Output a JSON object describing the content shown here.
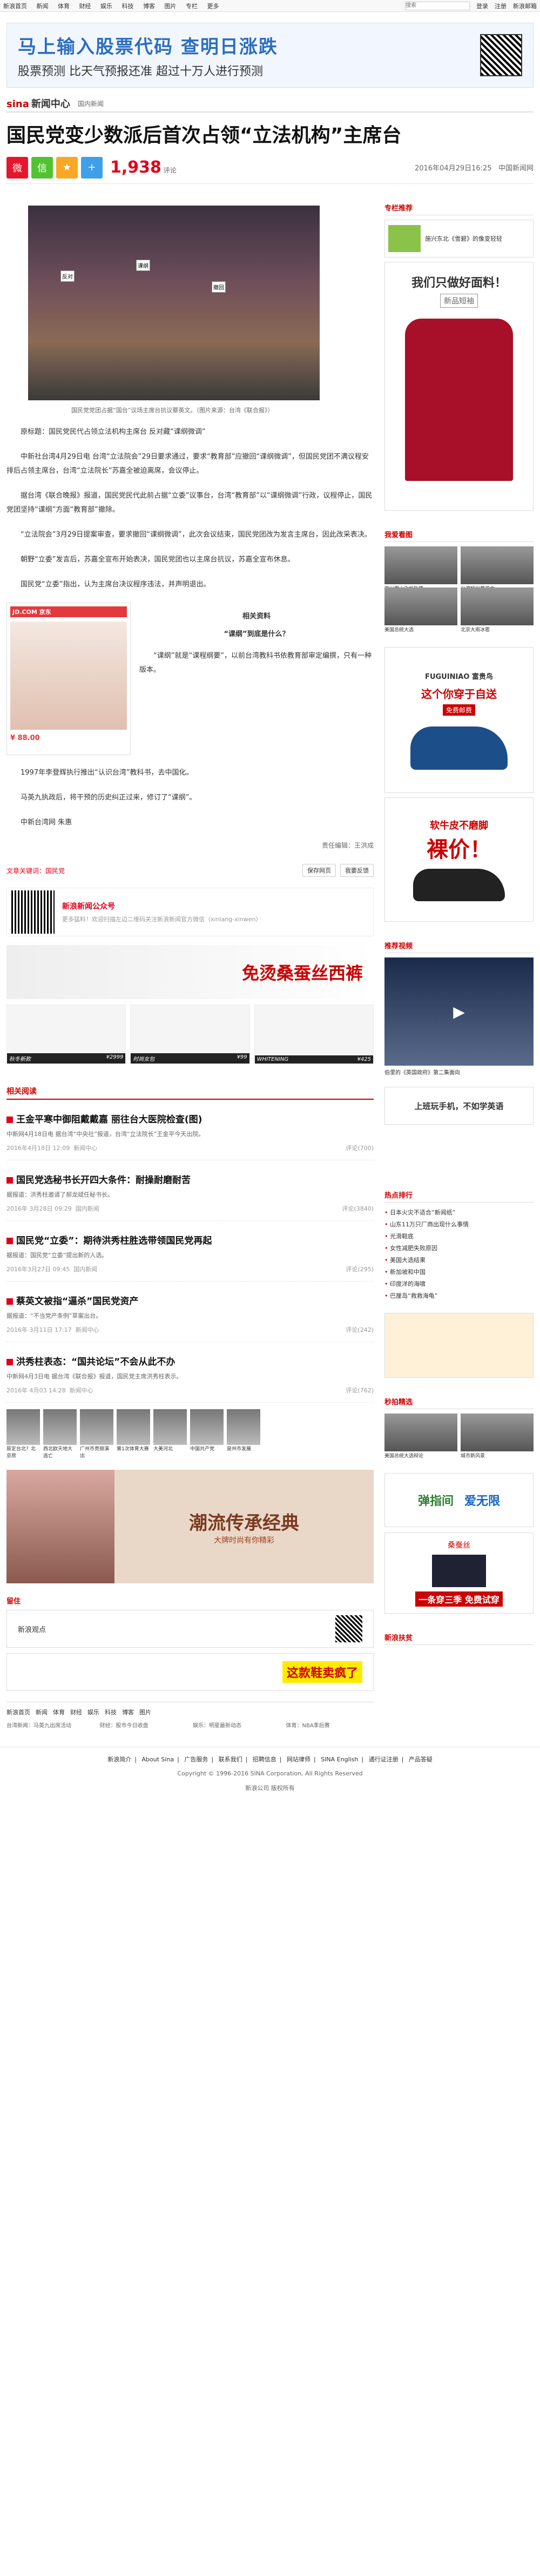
{
  "topbar": {
    "nav": [
      "新浪首页",
      "新闻",
      "体育",
      "财经",
      "娱乐",
      "科技",
      "博客",
      "图片",
      "专栏",
      "更多"
    ],
    "search_placeholder": "搜索",
    "login": "登录",
    "register": "注册",
    "mail": "新浪邮箱"
  },
  "banner": {
    "title": "马上输入股票代码  查明日涨跌",
    "sub": "股票预测  比天气预报还准  超过十万人进行预测"
  },
  "channel": {
    "logo": "sina",
    "name": "新闻中心",
    "crumb": "国内新闻"
  },
  "article": {
    "title": "国民党变少数派后首次占领“立法机构”主席台",
    "count": "1,938",
    "count_label": "评论",
    "date": "2016年04月29日16:25",
    "source": "中国新闻网",
    "caption": "国民党党团占据“国台”议场主席台抗议蔡英文。（图片来源：台湾《联合报》）",
    "p1": "原标题：国民党民代占领立法机构主席台 反对藏“课纲微调”",
    "p2": "中新社台湾4月29日电 台湾“立法院会”29日要求通过，要求“教育部”应撤回“课纲微调”，但国民党团不满议程安排后占领主席台，台湾“立法院长”苏嘉全被迫离席，会议停止。",
    "p3": "据台湾《联合晚报》报道，国民党民代此前占据“立委”议事台，台湾“教育部”以“课纲微调”行政，议程停止，国民党团坚持“课纲”方面“教育部”撤除。",
    "p4": "“立法院会”3月29日提案审查，要求撤回“课纲微调”，此次会议结束，国民党团改为发言主席台，因此改采表决。",
    "p5": "朝野“立委”发言后，苏嘉全宣布开始表决，国民党团也以主席台抗议，苏嘉全宣布休息。",
    "p6": "国民党“立委”指出，认为主席台决议程序违法，并声明退出。",
    "sub1": "相关资料",
    "sub2": "“课纲”到底是什么？",
    "p7": "“课纲”就是“课程纲要”，以前台湾教科书依教育部审定编撰，只有一种版本。",
    "p8": "1997年李登辉执行推出“认识台湾”教科书，去中国化。",
    "p9": "马英九执政后，将干预的历史纠正过来，修订了“课纲”。",
    "p10": "中新台湾网 朱惠",
    "editor": "责任编辑：王洪成",
    "tag_label": "文章关键词：",
    "tag": "国民党",
    "btn_save": "保存网页",
    "btn_print": "我要反馈"
  },
  "shopad": {
    "head": "JD.COM 京东",
    "price": "¥ 88.00"
  },
  "wechat": {
    "title": "新浪新闻公众号",
    "desc": "更多猛料！欢迎扫描左边二维码关注新浪新闻官方微信（xinlang-xinwen）"
  },
  "imgad": {
    "big": "免烫桑蚕丝西裤"
  },
  "products": [
    {
      "name": "秋冬新款",
      "price": "¥2999"
    },
    {
      "name": "时尚女包",
      "price": "¥99"
    },
    {
      "name": "WHITENING",
      "price": "¥425"
    }
  ],
  "news_header": "相关阅读",
  "news": [
    {
      "t": "王金平寒中御阻戴戴嘉 丽往台大医院检查(图)",
      "d": "中新网4月18日电 据台湾“中央社”报道，台湾“立法院长”王金平今天出院。",
      "date": "2016年4月18日 12:09",
      "src": "新闻中心",
      "comm": "评论(700)"
    },
    {
      "t": "国民党选秘书长开四大条件：耐操耐磨耐苦",
      "d": "据报道：洪秀柱邀请了郝龙斌任秘书长。",
      "date": "2016年 3月28日 09:29",
      "src": "国内新闻",
      "comm": "评论(3840)"
    },
    {
      "t": "国民党“立委”：期待洪秀柱胜选带领国民党再起",
      "d": "据报道：国民党“立委”提出新的人选。",
      "date": "2016年3月27日 09:45",
      "src": "国内新闻",
      "comm": "评论(295)"
    },
    {
      "t": "蔡英文被指“逼杀”国民党资产",
      "d": "据报道：“不当党产条例”草案出台。",
      "date": "2016年 3月11日 17:17",
      "src": "新闻中心",
      "comm": "评论(242)"
    },
    {
      "t": "洪秀柱表态：“国共论坛”不会从此不办",
      "d": "中新网4月3日电 据台湾《联合报》报道，国民党主席洪秀柱表示。",
      "date": "2016年 4月03 14:28",
      "src": "新闻中心",
      "comm": "评论(762)"
    }
  ],
  "thumbs": [
    "原定台北？北京房",
    "西北欧天地大逃亡",
    "广州市亮丽演出",
    "第1次体育大赛",
    "大美河北",
    "中国共产党",
    "泉州市发展"
  ],
  "bigad": {
    "title": "潮流传承经典",
    "sub": "大牌时尚有你精彩"
  },
  "weather": {
    "label": "留住",
    "ad": "新浪观点"
  },
  "shoes_ad": "这款鞋卖疯了",
  "footer_links": [
    "新浪首页",
    "新闻",
    "体育",
    "财经",
    "娱乐",
    "科技",
    "博客",
    "图片"
  ],
  "footer_cols": [
    "台湾新闻：马英九出席活动",
    "财经：股市今日收盘",
    "娱乐：明星最新动态",
    "体育：NBA季后赛"
  ],
  "side": {
    "rec_head": "专栏推荐",
    "rec_item": "施兴东北《雪碧》的像变轻轻",
    "ad1": "我们只做好面料！",
    "ad1_sub": "新品短袖",
    "photo_head": "我爱看图",
    "photos": [
      "四川眉山飞机坠落",
      "台湾疑似蔡英文",
      "美国总统大选",
      "北京大雨冰雹"
    ],
    "shoe_brand": "FUGUINIAO 富贵鸟",
    "shoe_title": "这个你穿于自送",
    "shoe_sub": "免费邮费",
    "shoe_ad2": "软牛皮不磨脚",
    "shoe_ad2_big": "裸价！",
    "video_head": "推荐视频",
    "video_cap": "伯里的《英国政府》第二集面向",
    "game_ad": "上班玩手机，不如学英语",
    "hot_head": "热点排行",
    "hot": [
      "日本火灾不适合“新闻纸”",
      "山东11万只厂商出现什么事情",
      "光滑鞋底",
      "女性减肥失败原因",
      "美国大选结果",
      "新加坡和中国",
      "印度洋的海啸",
      "巴厘岛“救救海龟”"
    ],
    "spike_head": "秒拍精选",
    "spike_caps": [
      "美国总统大选辩论",
      "城市新风景"
    ],
    "ads_end": [
      "弹指间",
      "爱无限"
    ],
    "suit": "桑蚕丝",
    "suit_big": "一条穿三季  免费试穿",
    "end_head": "新浪扶贫"
  },
  "bottom": {
    "links": [
      "新浪简介",
      "About Sina",
      "广告服务",
      "联系我们",
      "招聘信息",
      "网站律师",
      "SINA English",
      "通行证注册",
      "产品答疑"
    ],
    "copy": "Copyright © 1996-2016 SINA Corporation, All Rights Reserved",
    "company": "新浪公司 版权所有"
  }
}
